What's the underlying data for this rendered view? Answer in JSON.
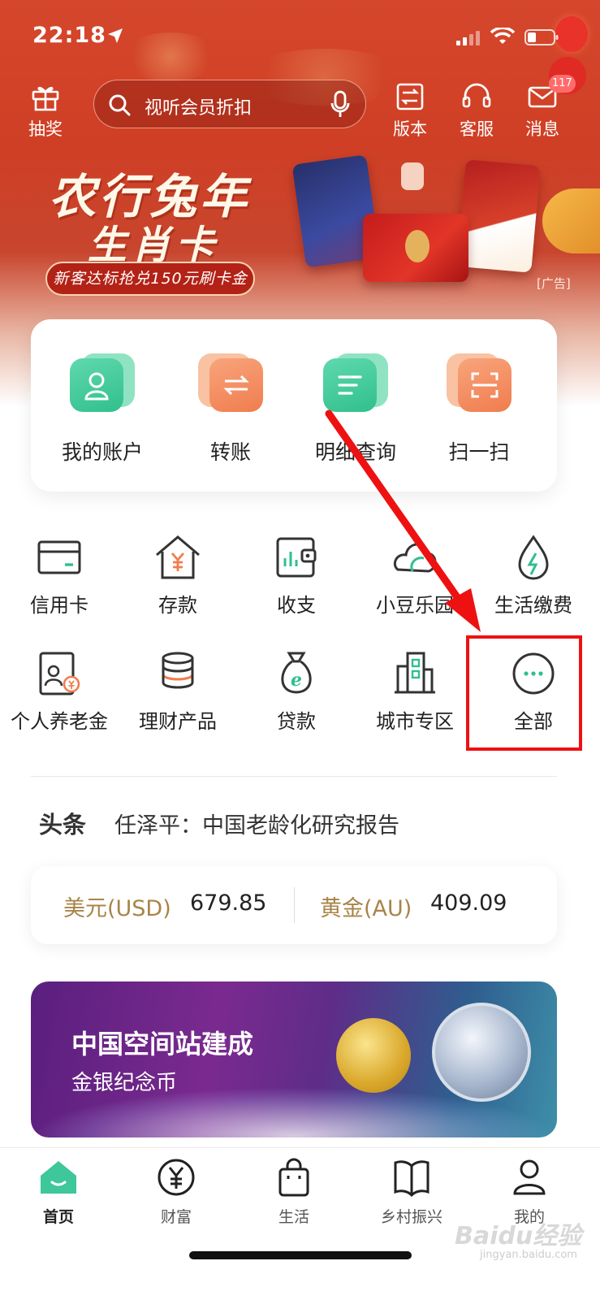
{
  "status_bar": {
    "time": "22:18"
  },
  "header": {
    "lottery_label": "抽奖",
    "search_placeholder": "视听会员折扣",
    "version_label": "版本",
    "service_label": "客服",
    "message_label": "消息",
    "message_badge": "117"
  },
  "banner": {
    "title": "农行兔年",
    "subtitle": "生肖卡",
    "offer": "新客达标抢兑150元刷卡金",
    "ad_tag": "[广告]"
  },
  "quick_actions": [
    {
      "label": "我的账户",
      "icon": "user-account-icon",
      "color": "#3dc79b"
    },
    {
      "label": "转账",
      "icon": "transfer-icon",
      "color": "#f28a5c"
    },
    {
      "label": "明细查询",
      "icon": "detail-list-icon",
      "color": "#3dc79b"
    },
    {
      "label": "扫一扫",
      "icon": "scan-icon",
      "color": "#f28a5c"
    }
  ],
  "grid": [
    {
      "label": "信用卡",
      "icon": "credit-card-icon"
    },
    {
      "label": "存款",
      "icon": "deposit-icon"
    },
    {
      "label": "收支",
      "icon": "wallet-icon"
    },
    {
      "label": "小豆乐园",
      "icon": "garden-icon"
    },
    {
      "label": "生活缴费",
      "icon": "utility-icon"
    },
    {
      "label": "个人养老金",
      "icon": "pension-icon"
    },
    {
      "label": "理财产品",
      "icon": "wealth-product-icon"
    },
    {
      "label": "贷款",
      "icon": "loan-icon"
    },
    {
      "label": "城市专区",
      "icon": "city-icon"
    },
    {
      "label": "全部",
      "icon": "more-icon"
    }
  ],
  "news": {
    "tag": "头条",
    "headline": "任泽平：中国老龄化研究报告"
  },
  "rates": {
    "usd_label": "美元(USD)",
    "usd_value": "679.85",
    "gold_label": "黄金(AU)",
    "gold_value": "409.09"
  },
  "promo": {
    "title": "中国空间站建成",
    "subtitle": "金银纪念币"
  },
  "tabbar": [
    {
      "label": "首页",
      "icon": "home-icon",
      "active": true
    },
    {
      "label": "财富",
      "icon": "yuan-icon",
      "active": false
    },
    {
      "label": "生活",
      "icon": "shopping-bag-icon",
      "active": false
    },
    {
      "label": "乡村振兴",
      "icon": "book-icon",
      "active": false
    },
    {
      "label": "我的",
      "icon": "profile-icon",
      "active": false
    }
  ],
  "watermark": {
    "brand": "Baidu经验",
    "url": "jingyan.baidu.com"
  },
  "colors": {
    "brand_green": "#3dc79b",
    "banner_red": "#d5472c",
    "highlight_red": "#ee1111",
    "gold_text": "#a88449"
  }
}
